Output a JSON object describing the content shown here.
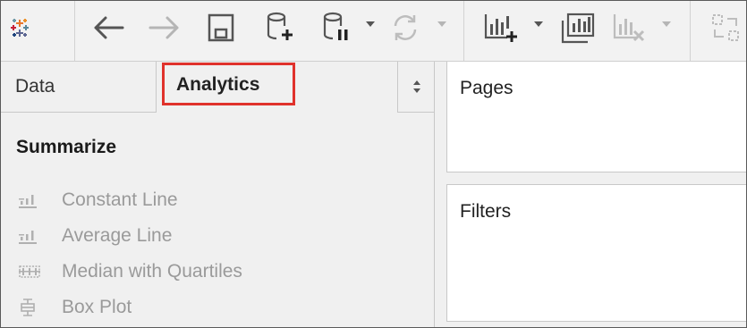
{
  "toolbar": {
    "icons": [
      "tableau-logo-icon",
      "back-icon",
      "forward-icon",
      "save-icon",
      "new-datasource-icon",
      "pause-datasource-icon",
      "refresh-icon",
      "new-worksheet-icon",
      "duplicate-sheet-icon",
      "clear-sheet-icon",
      "swap-icon"
    ]
  },
  "tabs": {
    "data": "Data",
    "analytics": "Analytics"
  },
  "summarize": {
    "title": "Summarize",
    "items": [
      {
        "label": "Constant Line",
        "icon": "constant-line-icon"
      },
      {
        "label": "Average Line",
        "icon": "average-line-icon"
      },
      {
        "label": "Median with Quartiles",
        "icon": "median-quartiles-icon"
      },
      {
        "label": "Box Plot",
        "icon": "box-plot-icon"
      }
    ]
  },
  "shelves": {
    "pages": "Pages",
    "filters": "Filters"
  },
  "colors": {
    "highlight": "#e0322c",
    "disabled_text": "#9a9a9a"
  }
}
